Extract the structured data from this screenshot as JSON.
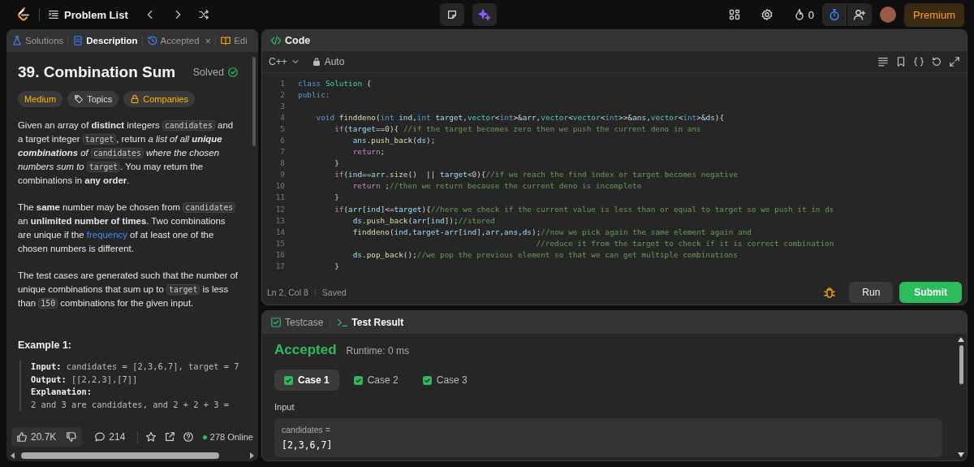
{
  "top_bar": {
    "nav_label": "Problem List",
    "streak": "0",
    "premium": "Premium"
  },
  "left_tabs": [
    {
      "label": "Solutions",
      "selected": false
    },
    {
      "label": "Description",
      "selected": true
    },
    {
      "label": "Accepted",
      "selected": false,
      "close": "×"
    },
    {
      "label": "Edi",
      "selected": false
    }
  ],
  "problem": {
    "title": "39. Combination Sum",
    "status": "Solved",
    "tags": [
      {
        "label": "Medium"
      },
      {
        "label": "Topics"
      },
      {
        "label": "Companies"
      }
    ],
    "paragraphs": [
      [
        {
          "kind": "text",
          "text": "Given an array of **distinct** integers "
        },
        {
          "kind": "code",
          "text": "candidates"
        },
        {
          "kind": "text",
          "text": " and a target integer "
        },
        {
          "kind": "code",
          "text": "target"
        },
        {
          "kind": "text",
          "text": ", return *a list of all* "
        },
        {
          "kind": "strong_em",
          "text": "unique combinations"
        },
        {
          "kind": "text",
          "text": " *of* "
        },
        {
          "kind": "code",
          "text": "candidates"
        },
        {
          "kind": "text",
          "text": " *where the chosen numbers sum to* "
        },
        {
          "kind": "code",
          "text": "target"
        },
        {
          "kind": "text",
          "text": ". You may return the combinations in **any order**."
        }
      ],
      [
        {
          "kind": "text",
          "text": "The **same** number may be chosen from "
        },
        {
          "kind": "code",
          "text": "candidates"
        },
        {
          "kind": "text",
          "text": " an **unlimited number of times**. Two combinations are unique if the "
        },
        {
          "kind": "link",
          "text": "frequency"
        },
        {
          "kind": "text",
          "text": " of at least one of the chosen numbers is different."
        }
      ],
      [
        {
          "kind": "text",
          "text": "The test cases are generated such that the number of unique combinations that sum up to "
        },
        {
          "kind": "code",
          "text": "target"
        },
        {
          "kind": "text",
          "text": " is less than "
        },
        {
          "kind": "code",
          "text": "150"
        },
        {
          "kind": "text",
          "text": " combinations for the given input."
        }
      ]
    ],
    "example": {
      "title": "Example 1:",
      "lines": [
        "**Input:** candidates = [2,3,6,7], target = 7",
        "**Output:** [[2,2,3],[7]]",
        "**Explanation:**",
        "2 and 3 are candidates, and 2 + 2 + 3 ="
      ]
    }
  },
  "stats": {
    "likes": "20.7K",
    "comments": "214",
    "online": "278 Online"
  },
  "code_panel": {
    "title": "Code",
    "language": "C++",
    "mode": "Auto",
    "lines": [
      {
        "number": "1",
        "segments": [
          {
            "kind": "kw",
            "text": "class "
          },
          {
            "kind": "type",
            "text": "Solution "
          },
          {
            "kind": "plain",
            "text": "{"
          }
        ]
      },
      {
        "number": "2",
        "segments": [
          {
            "kind": "kw",
            "text": "public:"
          }
        ]
      },
      {
        "number": "3"
      },
      {
        "number": "4",
        "segments": [
          {
            "kind": "kw",
            "text": "    void "
          },
          {
            "kind": "fn",
            "text": "finddeno"
          },
          {
            "kind": "plain",
            "text": "("
          },
          {
            "kind": "kw",
            "text": "int "
          },
          {
            "kind": "var",
            "text": "ind"
          },
          {
            "kind": "plain",
            "text": ","
          },
          {
            "kind": "kw",
            "text": "int "
          },
          {
            "kind": "var",
            "text": "target"
          },
          {
            "kind": "plain",
            "text": ","
          },
          {
            "kind": "type",
            "text": "vector"
          },
          {
            "kind": "plain",
            "text": "<"
          },
          {
            "kind": "kw",
            "text": "int"
          },
          {
            "kind": "plain",
            "text": ">&"
          },
          {
            "kind": "var",
            "text": "arr"
          },
          {
            "kind": "plain",
            "text": ","
          },
          {
            "kind": "type",
            "text": "vector"
          },
          {
            "kind": "plain",
            "text": "<"
          },
          {
            "kind": "type",
            "text": "vector"
          },
          {
            "kind": "plain",
            "text": "<"
          },
          {
            "kind": "kw",
            "text": "int"
          },
          {
            "kind": "plain",
            "text": ">>&"
          },
          {
            "kind": "var",
            "text": "ans"
          },
          {
            "kind": "plain",
            "text": ","
          },
          {
            "kind": "type",
            "text": "vector"
          },
          {
            "kind": "plain",
            "text": "<"
          },
          {
            "kind": "kw",
            "text": "int"
          },
          {
            "kind": "plain",
            "text": ">&"
          },
          {
            "kind": "var",
            "text": "ds"
          },
          {
            "kind": "plain",
            "text": "){"
          }
        ]
      },
      {
        "number": "5",
        "segments": [
          {
            "kind": "ctrl",
            "text": "        if"
          },
          {
            "kind": "plain",
            "text": "("
          },
          {
            "kind": "var",
            "text": "target"
          },
          {
            "kind": "plain",
            "text": "=="
          },
          {
            "kind": "num",
            "text": "0"
          },
          {
            "kind": "plain",
            "text": "){ "
          },
          {
            "kind": "comment",
            "text": "//if the target becomes zero then we push the current deno in ans"
          }
        ]
      },
      {
        "number": "6",
        "segments": [
          {
            "kind": "var",
            "text": "            ans"
          },
          {
            "kind": "plain",
            "text": "."
          },
          {
            "kind": "fn",
            "text": "push_back"
          },
          {
            "kind": "plain",
            "text": "("
          },
          {
            "kind": "var",
            "text": "ds"
          },
          {
            "kind": "plain",
            "text": ");"
          }
        ]
      },
      {
        "number": "7",
        "segments": [
          {
            "kind": "ctrl",
            "text": "            return"
          },
          {
            "kind": "plain",
            "text": ";"
          }
        ]
      },
      {
        "number": "8",
        "segments": [
          {
            "kind": "plain",
            "text": "        }"
          }
        ]
      },
      {
        "number": "9",
        "segments": [
          {
            "kind": "ctrl",
            "text": "        if"
          },
          {
            "kind": "plain",
            "text": "("
          },
          {
            "kind": "var",
            "text": "ind"
          },
          {
            "kind": "plain",
            "text": "=="
          },
          {
            "kind": "var",
            "text": "arr"
          },
          {
            "kind": "plain",
            "text": "."
          },
          {
            "kind": "fn",
            "text": "size"
          },
          {
            "kind": "plain",
            "text": "()  || "
          },
          {
            "kind": "var",
            "text": "target"
          },
          {
            "kind": "plain",
            "text": "<"
          },
          {
            "kind": "num",
            "text": "0"
          },
          {
            "kind": "plain",
            "text": "){"
          },
          {
            "kind": "comment",
            "text": "//if we reach the find index or target becomes negative"
          }
        ]
      },
      {
        "number": "10",
        "segments": [
          {
            "kind": "ctrl",
            "text": "            return"
          },
          {
            "kind": "plain",
            "text": " ;"
          },
          {
            "kind": "comment",
            "text": "//then we return because the current deno is incomplete"
          }
        ]
      },
      {
        "number": "11",
        "segments": [
          {
            "kind": "plain",
            "text": "        }"
          }
        ]
      },
      {
        "number": "12",
        "segments": [
          {
            "kind": "ctrl",
            "text": "        if"
          },
          {
            "kind": "plain",
            "text": "("
          },
          {
            "kind": "var",
            "text": "arr"
          },
          {
            "kind": "plain",
            "text": "["
          },
          {
            "kind": "var",
            "text": "ind"
          },
          {
            "kind": "plain",
            "text": "]<="
          },
          {
            "kind": "var",
            "text": "target"
          },
          {
            "kind": "plain",
            "text": "){"
          },
          {
            "kind": "comment",
            "text": "//here we check if the current value is less than or equal to target so we push it in ds"
          }
        ]
      },
      {
        "number": "13",
        "segments": [
          {
            "kind": "var",
            "text": "            ds"
          },
          {
            "kind": "plain",
            "text": "."
          },
          {
            "kind": "fn",
            "text": "push_back"
          },
          {
            "kind": "plain",
            "text": "("
          },
          {
            "kind": "var",
            "text": "arr"
          },
          {
            "kind": "plain",
            "text": "["
          },
          {
            "kind": "var",
            "text": "ind"
          },
          {
            "kind": "plain",
            "text": "]);"
          },
          {
            "kind": "comment",
            "text": "//stored"
          }
        ]
      },
      {
        "number": "14",
        "segments": [
          {
            "kind": "fn",
            "text": "            finddeno"
          },
          {
            "kind": "plain",
            "text": "("
          },
          {
            "kind": "var",
            "text": "ind"
          },
          {
            "kind": "plain",
            "text": ","
          },
          {
            "kind": "var",
            "text": "target"
          },
          {
            "kind": "plain",
            "text": "-"
          },
          {
            "kind": "var",
            "text": "arr"
          },
          {
            "kind": "plain",
            "text": "["
          },
          {
            "kind": "var",
            "text": "ind"
          },
          {
            "kind": "plain",
            "text": "],"
          },
          {
            "kind": "var",
            "text": "arr"
          },
          {
            "kind": "plain",
            "text": ","
          },
          {
            "kind": "var",
            "text": "ans"
          },
          {
            "kind": "plain",
            "text": ","
          },
          {
            "kind": "var",
            "text": "ds"
          },
          {
            "kind": "plain",
            "text": ");"
          },
          {
            "kind": "comment",
            "text": "//now we pick again the same element again and"
          }
        ]
      },
      {
        "number": "15",
        "segments": [
          {
            "kind": "comment",
            "text": "                                                    //reduce it from the target to check if it is correct combination"
          }
        ]
      },
      {
        "number": "16",
        "segments": [
          {
            "kind": "var",
            "text": "            ds"
          },
          {
            "kind": "plain",
            "text": "."
          },
          {
            "kind": "fn",
            "text": "pop_back"
          },
          {
            "kind": "plain",
            "text": "();"
          },
          {
            "kind": "comment",
            "text": "//we pop the previous element so that we can get multiple combinations"
          }
        ]
      },
      {
        "number": "17",
        "segments": [
          {
            "kind": "plain",
            "text": "        }"
          }
        ]
      }
    ],
    "cursor": "Ln 2, Col 8",
    "save_state": "Saved",
    "run": "Run",
    "submit": "Submit"
  },
  "test_panel": {
    "tabs": [
      {
        "label": "Testcase",
        "selected": false
      },
      {
        "label": "Test Result",
        "selected": true
      }
    ],
    "verdict": "Accepted",
    "runtime": "Runtime: 0 ms",
    "cases": [
      {
        "label": "Case 1",
        "selected": true,
        "checked": true
      },
      {
        "label": "Case 2",
        "selected": false,
        "checked": true
      },
      {
        "label": "Case 3",
        "selected": false,
        "checked": true
      }
    ],
    "input_label": "Input",
    "input_name": "candidates =",
    "input_value": "[2,3,6,7]"
  }
}
